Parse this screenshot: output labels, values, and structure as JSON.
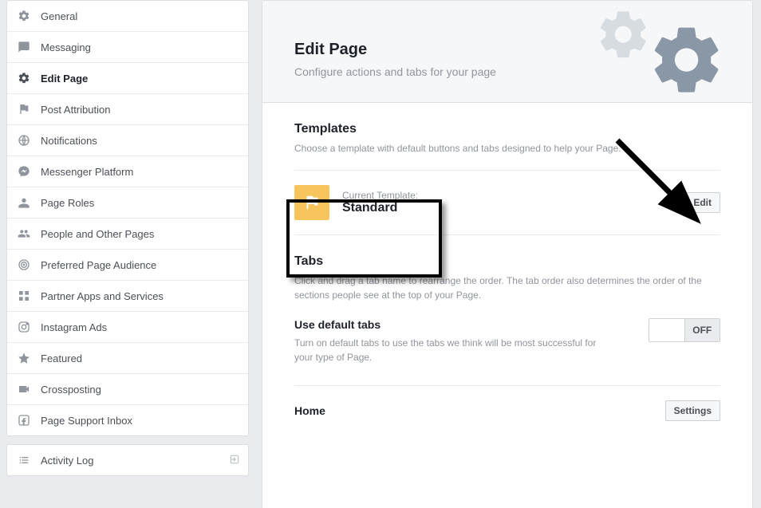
{
  "sidebar": {
    "items": [
      {
        "label": "General",
        "icon": "gear"
      },
      {
        "label": "Messaging",
        "icon": "chat"
      },
      {
        "label": "Edit Page",
        "icon": "gear",
        "selected": true
      },
      {
        "label": "Post Attribution",
        "icon": "flag"
      },
      {
        "label": "Notifications",
        "icon": "globe"
      },
      {
        "label": "Messenger Platform",
        "icon": "messenger"
      },
      {
        "label": "Page Roles",
        "icon": "person"
      },
      {
        "label": "People and Other Pages",
        "icon": "people"
      },
      {
        "label": "Preferred Page Audience",
        "icon": "target"
      },
      {
        "label": "Partner Apps and Services",
        "icon": "grid"
      },
      {
        "label": "Instagram Ads",
        "icon": "instagram"
      },
      {
        "label": "Featured",
        "icon": "star"
      },
      {
        "label": "Crossposting",
        "icon": "video"
      },
      {
        "label": "Page Support Inbox",
        "icon": "fb"
      }
    ],
    "activity_log": "Activity Log"
  },
  "header": {
    "title": "Edit Page",
    "subtitle": "Configure actions and tabs for your page"
  },
  "templates": {
    "heading": "Templates",
    "desc": "Choose a template with default buttons and tabs designed to help your Page.",
    "current_label": "Current Template:",
    "current_name": "Standard",
    "edit_button": "Edit"
  },
  "tabs": {
    "heading": "Tabs",
    "desc": "Click and drag a tab name to rearrange the order. The tab order also determines the order of the sections people see at the top of your Page.",
    "default_heading": "Use default tabs",
    "default_desc": "Turn on default tabs to use the tabs we think will be most successful for your type of Page.",
    "switch_state": "OFF",
    "home_label": "Home",
    "settings_button": "Settings"
  }
}
